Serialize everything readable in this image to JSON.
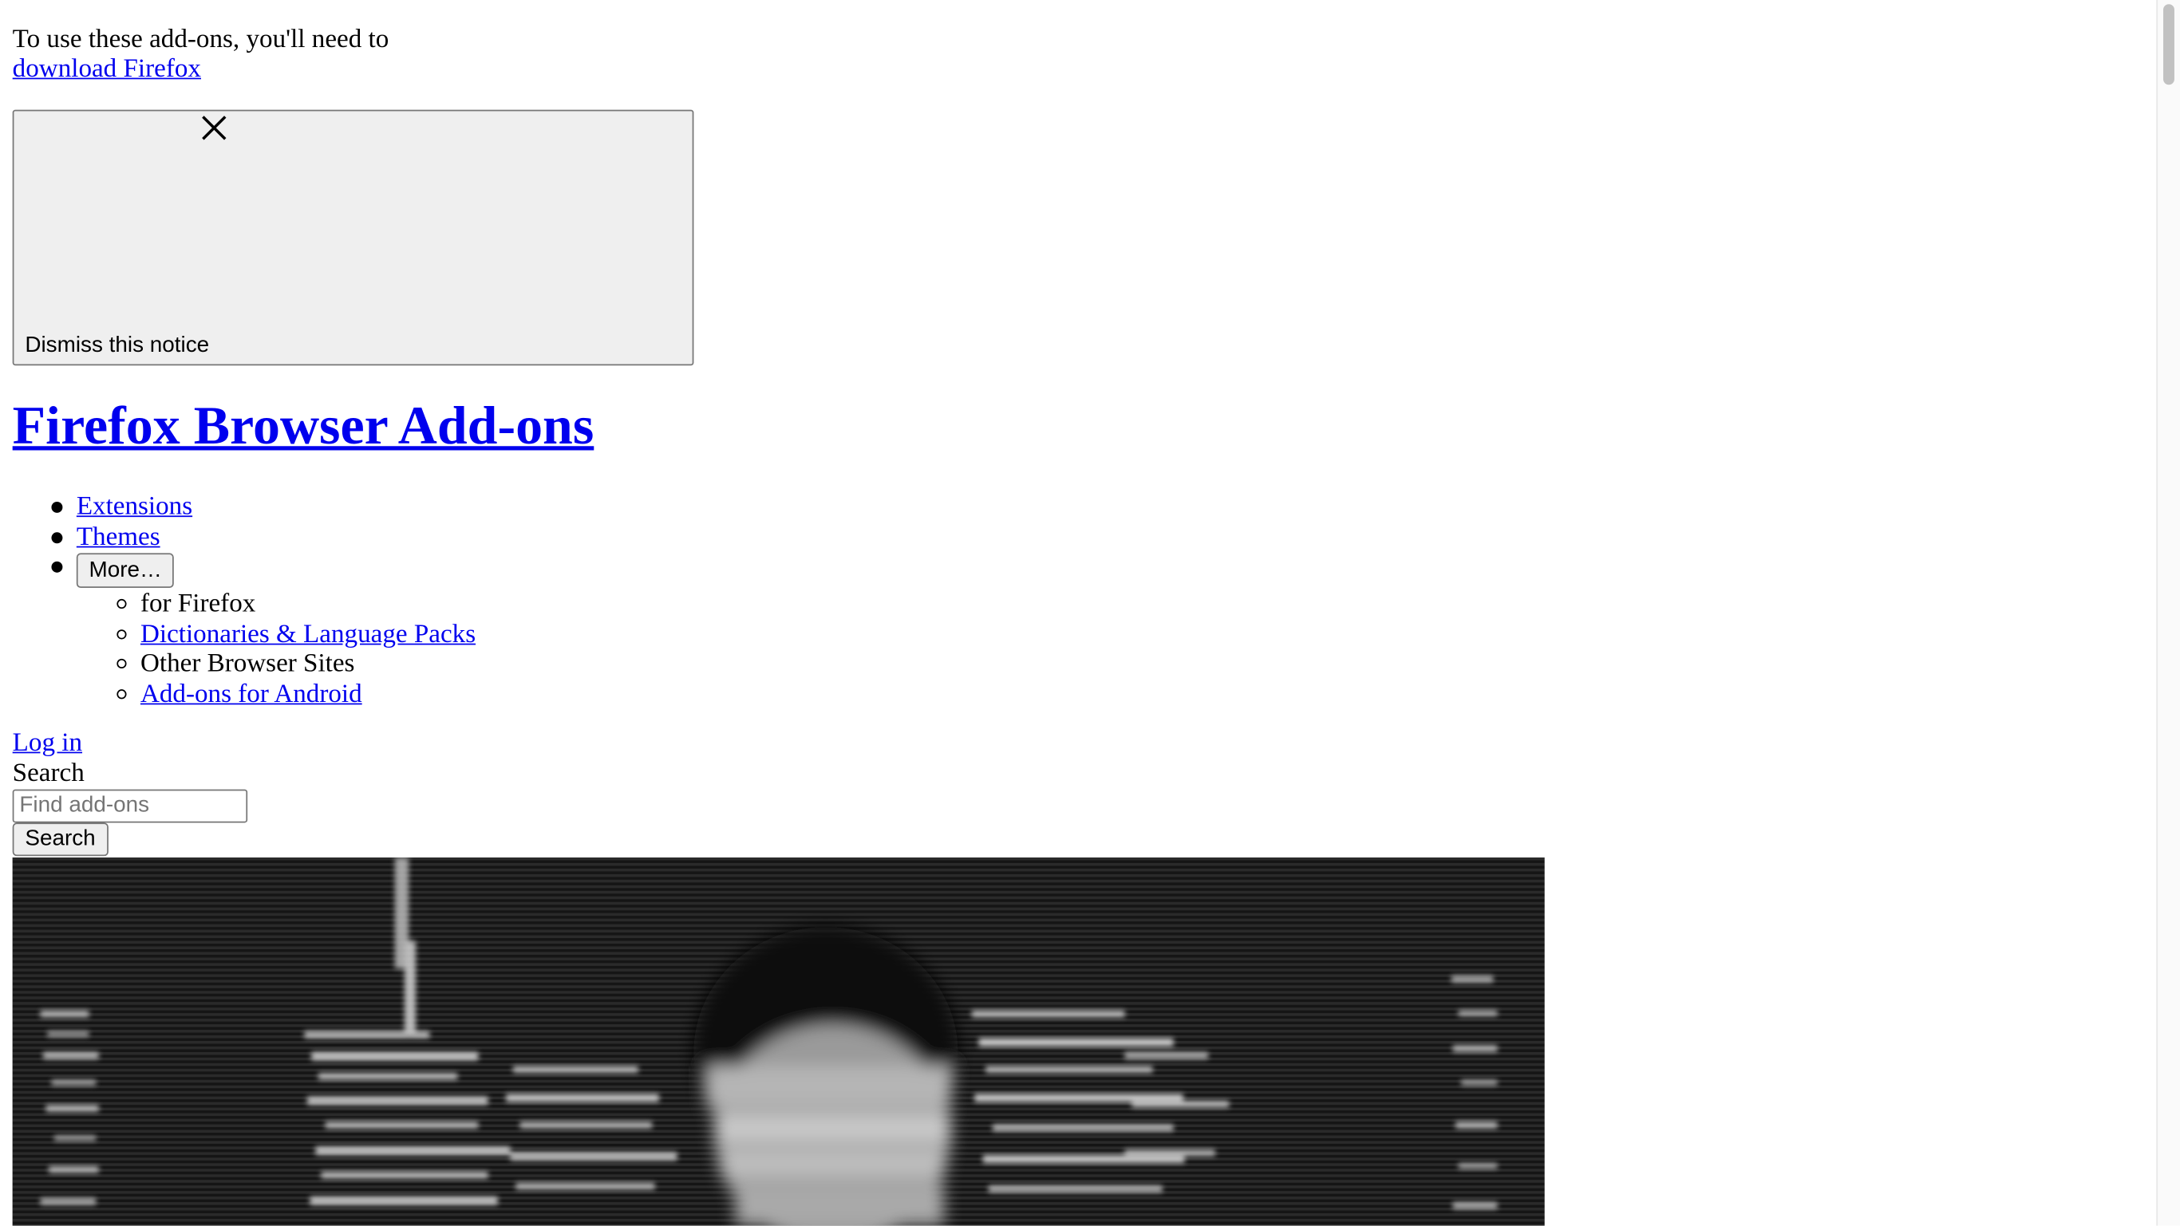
{
  "notice": {
    "text": "To use these add-ons, you'll need to",
    "link_label": "download Firefox",
    "dismiss_label": "Dismiss this notice"
  },
  "header": {
    "site_title": "Firefox Browser Add-ons"
  },
  "nav": {
    "items": [
      {
        "label": "Extensions"
      },
      {
        "label": "Themes"
      }
    ],
    "more_label": "More…",
    "submenu": [
      {
        "label": "for Firefox",
        "link": false
      },
      {
        "label": "Dictionaries & Language Packs",
        "link": true
      },
      {
        "label": "Other Browser Sites",
        "link": false
      },
      {
        "label": "Add-ons for Android",
        "link": true
      }
    ]
  },
  "account": {
    "login_label": "Log in"
  },
  "search": {
    "label": "Search",
    "placeholder": "Find add-ons",
    "button_label": "Search"
  },
  "colors": {
    "link": "#0000ee",
    "button_bg": "#efefef",
    "hero_bg": "#1a1a1a"
  }
}
